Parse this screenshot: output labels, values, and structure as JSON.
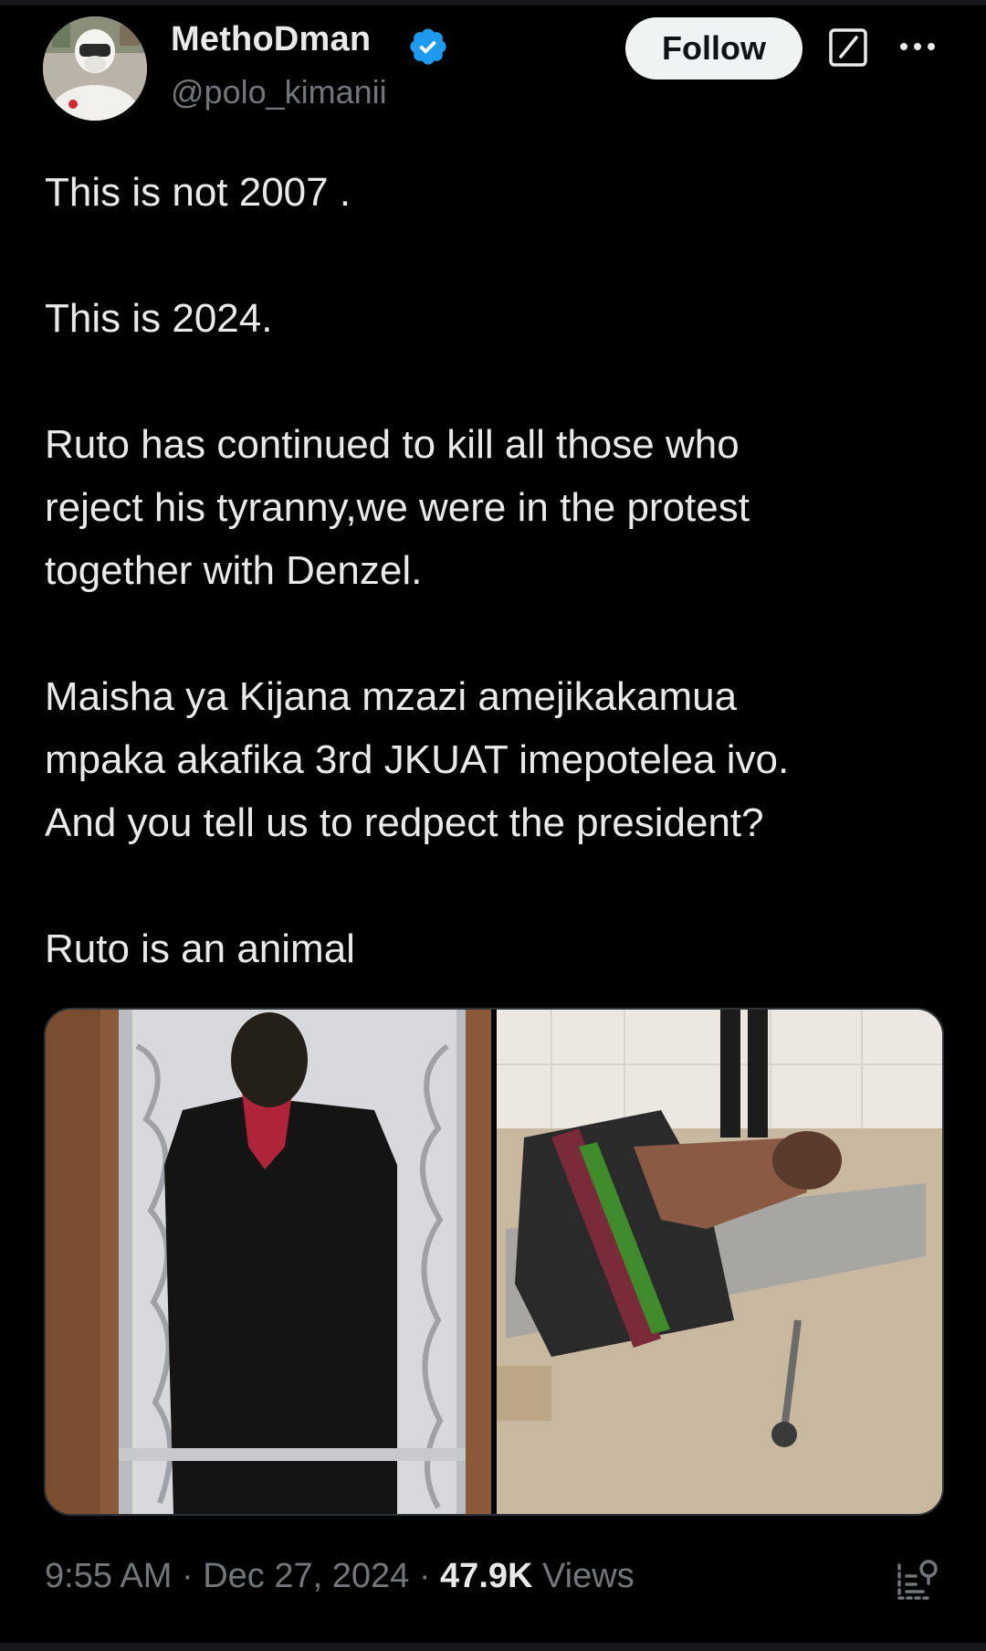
{
  "author": {
    "name": "MethoDman",
    "handle": "@polo_kimanii",
    "verified": true,
    "avatar_icon": "avatar-masked-person"
  },
  "header": {
    "follow_label": "Follow",
    "grok_icon": "grok-icon",
    "more_icon": "more-icon"
  },
  "tweet": {
    "paragraphs": [
      "This is not 2007 .",
      "This is 2024.",
      "Ruto has continued to kill all those who reject his tyranny,we were in the protest together with Denzel.",
      "Maisha ya Kijana mzazi amejikakamua mpaka akafika 3rd JKUAT imepotelea ivo. And you tell us to redpect the president?",
      "Ruto is an animal"
    ],
    "line_1a": "This is not 2007 .",
    "line_2a": "This is 2024.",
    "line_3a": "Ruto has continued to kill all those who",
    "line_3b": "reject his tyranny,we were in the protest",
    "line_3c": "together with Denzel.",
    "line_4a": "Maisha ya Kijana mzazi amejikakamua",
    "line_4b": "mpaka akafika 3rd JKUAT imepotelea ivo.",
    "line_4c": "And you tell us to redpect the president?",
    "line_5a": "Ruto is an animal"
  },
  "media": {
    "count": 2,
    "images": [
      "photo-1",
      "photo-2"
    ]
  },
  "meta": {
    "time": "9:55 AM",
    "date": "Dec 27, 2024",
    "separator": "·",
    "views_count": "47.9K",
    "views_label": "Views"
  },
  "colors": {
    "background": "#000000",
    "text": "#e7e9ea",
    "secondary": "#71767b",
    "verified": "#1d9bf0",
    "follow_bg": "#eff3f4"
  }
}
